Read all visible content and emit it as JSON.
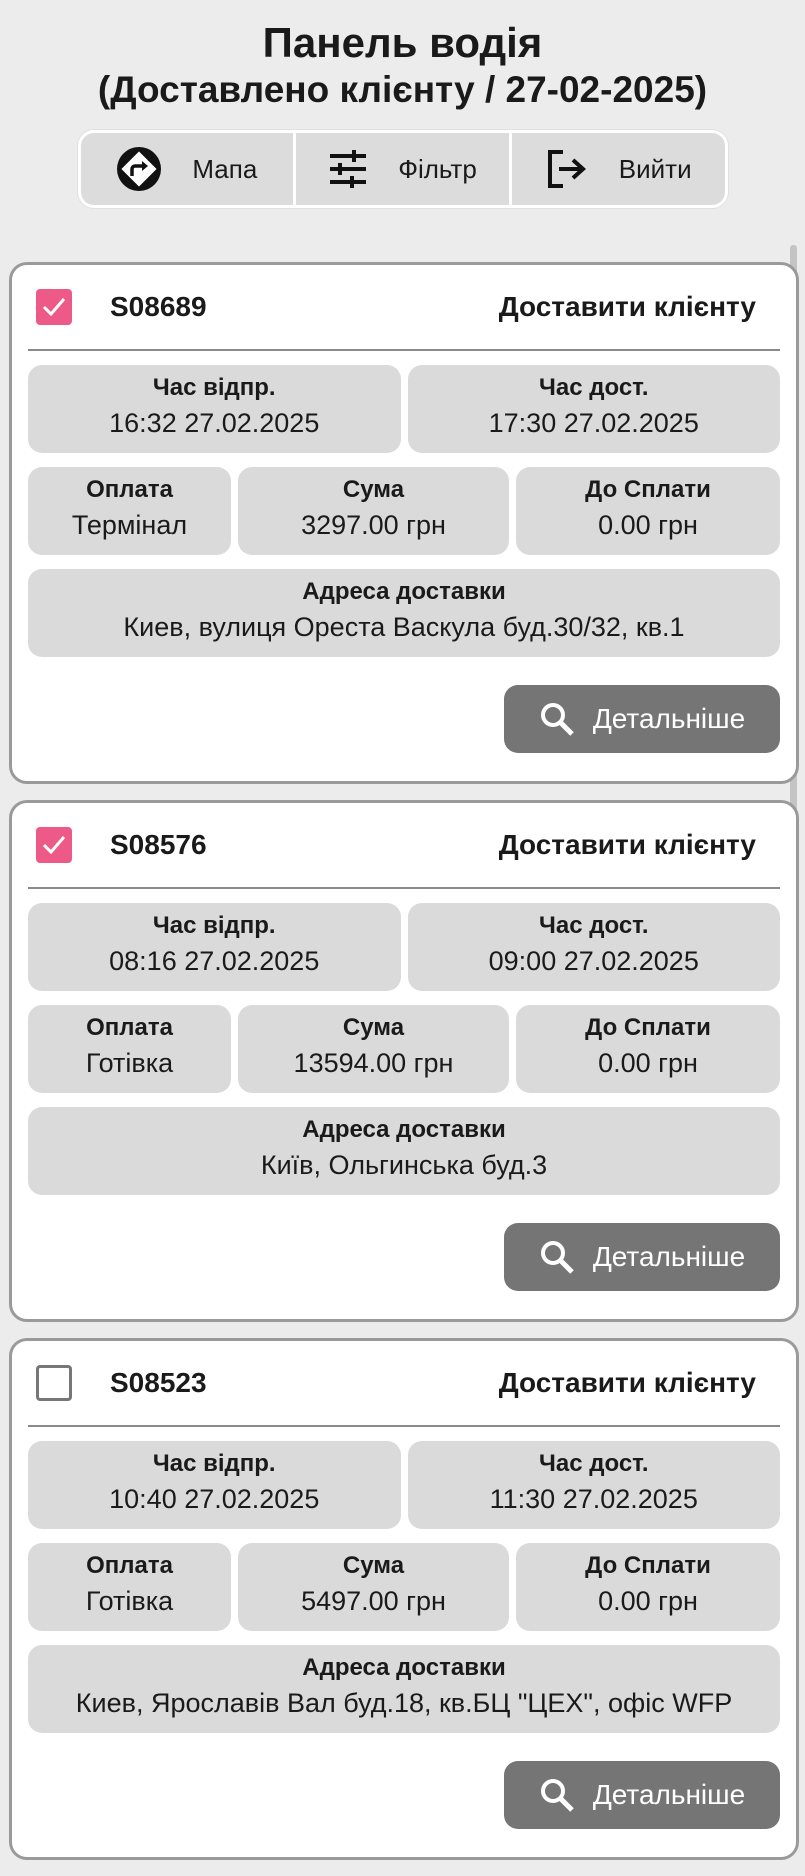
{
  "header": {
    "title": "Панель водія",
    "subtitle": "(Доставлено клієнту / 27-02-2025)"
  },
  "toolbar": {
    "map_label": "Мапа",
    "filter_label": "Фільтр",
    "logout_label": "Вийти"
  },
  "labels": {
    "departure": "Час відпр.",
    "delivery": "Час дост.",
    "payment": "Оплата",
    "amount": "Сума",
    "due": "До Сплати",
    "address": "Адреса доставки",
    "details_button": "Детальніше"
  },
  "orders": [
    {
      "checked": true,
      "number": "S08689",
      "status": "Доставити клієнту",
      "departure": "16:32 27.02.2025",
      "delivery": "17:30 27.02.2025",
      "payment": "Термінал",
      "amount": "3297.00 грн",
      "due": "0.00 грн",
      "address": "Киев, вулиця Ореста Васкула буд.30/32, кв.1"
    },
    {
      "checked": true,
      "number": "S08576",
      "status": "Доставити клієнту",
      "departure": "08:16 27.02.2025",
      "delivery": "09:00 27.02.2025",
      "payment": "Готівка",
      "amount": "13594.00 грн",
      "due": "0.00 грн",
      "address": "Київ, Ольгинська буд.3"
    },
    {
      "checked": false,
      "number": "S08523",
      "status": "Доставити клієнту",
      "departure": "10:40 27.02.2025",
      "delivery": "11:30 27.02.2025",
      "payment": "Готівка",
      "amount": "5497.00 грн",
      "due": "0.00 грн",
      "address": "Киев, Ярославів Вал буд.18, кв.БЦ \"ЦЕХ\", офіс WFP"
    }
  ],
  "colors": {
    "checkbox_checked": "#ee5a87",
    "details_button": "#757575",
    "cell_background": "#dadada"
  }
}
